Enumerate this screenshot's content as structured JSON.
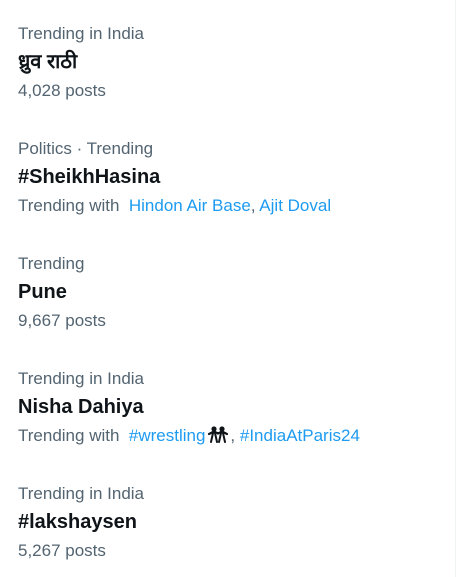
{
  "trends": [
    {
      "context": "Trending in India",
      "name": "ध्रुव राठी",
      "posts": "4,028 posts"
    },
    {
      "context": "Politics · Trending",
      "name": "#SheikhHasina",
      "with_prefix": "Trending with",
      "with_links": [
        "Hindon Air Base",
        "Ajit Doval"
      ]
    },
    {
      "context": "Trending",
      "name": "Pune",
      "posts": "9,667 posts"
    },
    {
      "context": "Trending in India",
      "name": "Nisha Dahiya",
      "with_prefix": "Trending with",
      "with_links": [
        "#wrestling",
        "#IndiaAtParis24"
      ],
      "with_icon": "wrestlers-icon"
    },
    {
      "context": "Trending in India",
      "name": "#lakshaysen",
      "posts": "5,267 posts"
    }
  ],
  "colors": {
    "text_primary": "#0f1419",
    "text_secondary": "#536471",
    "link": "#1d9bf0"
  }
}
